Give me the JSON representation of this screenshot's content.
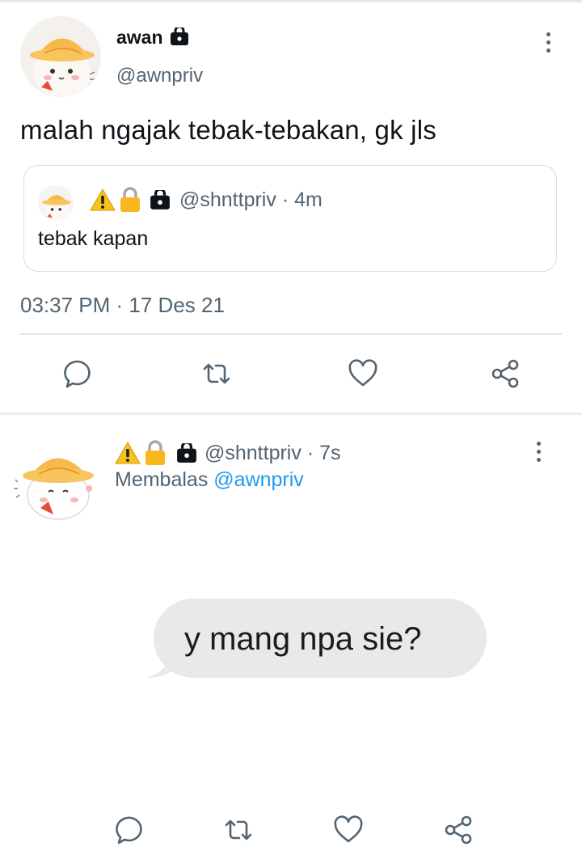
{
  "tweet1": {
    "display_name": "awan",
    "handle": "@awnpriv",
    "text": "malah ngajak tebak-tebakan, gk jls",
    "quote": {
      "handle": "@shnttpriv",
      "time": "· 4m",
      "text": "tebak kapan"
    },
    "timestamp": "03:37 PM · 17 Des 21"
  },
  "tweet2": {
    "handle": "@shnttpriv",
    "time": "· 7s",
    "reply_prefix": "Membalas",
    "reply_to": "@awnpriv",
    "bubble_text": "y mang npa sie?"
  },
  "icons": {
    "reply": "reply-icon",
    "retweet": "retweet-icon",
    "like": "heart-icon",
    "share": "share-icon",
    "lock": "lock-icon",
    "warning": "warning-emoji",
    "padlock": "padlock-emoji",
    "more": "more-options-icon"
  },
  "colors": {
    "text": "#0f1419",
    "secondary": "#536471",
    "link": "#1d9bf0",
    "bubble": "#e9e9eb"
  }
}
